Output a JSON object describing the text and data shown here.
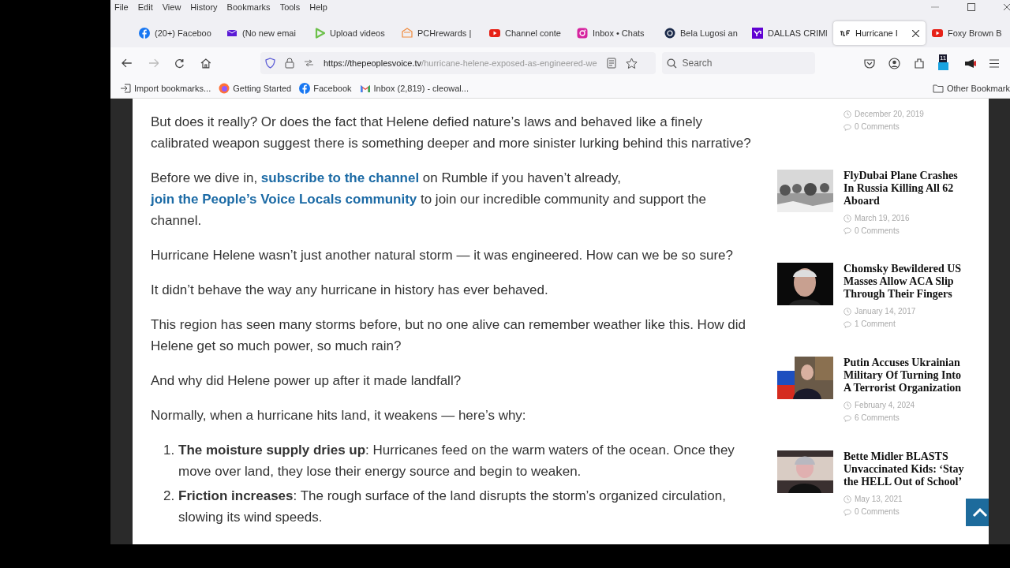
{
  "menu": [
    "File",
    "Edit",
    "View",
    "History",
    "Bookmarks",
    "Tools",
    "Help"
  ],
  "tabs": [
    {
      "label": "(20+) Faceboo",
      "kind": "facebook",
      "selected": false
    },
    {
      "label": "(No new emai",
      "kind": "mail",
      "selected": false
    },
    {
      "label": "Upload videos",
      "kind": "play",
      "selected": false
    },
    {
      "label": "PCHrewards |",
      "kind": "pch",
      "selected": false
    },
    {
      "label": "Channel conte",
      "kind": "youtube",
      "selected": false
    },
    {
      "label": "Inbox • Chats",
      "kind": "instagram",
      "selected": false
    },
    {
      "label": "Bela Lugosi an",
      "kind": "circle",
      "selected": false
    },
    {
      "label": "DALLAS CRIMI",
      "kind": "yahoo",
      "selected": false
    },
    {
      "label": "Hurricane I",
      "kind": "site",
      "selected": true
    },
    {
      "label": "Foxy Brown B",
      "kind": "youtube",
      "selected": false
    }
  ],
  "url": {
    "host": "https://thepeoplesvoice.tv",
    "path": "/hurricane-helene-exposed-as-engineered-we"
  },
  "search": {
    "placeholder": "Search"
  },
  "extension_badge": "11",
  "bookmarks": [
    {
      "label": "Import bookmarks...",
      "kind": "import"
    },
    {
      "label": "Getting Started",
      "kind": "firefox"
    },
    {
      "label": "Facebook",
      "kind": "facebook"
    },
    {
      "label": "Inbox (2,819) - cleowal...",
      "kind": "gmail"
    }
  ],
  "other_bookmarks": "Other Bookmark",
  "article": [
    {
      "kind": "p",
      "segments": [
        {
          "text": "But does it really? Or does the fact that Helene defied nature’s laws and behaved like a finely calibrated weapon suggest there is something deeper and more sinister lurking behind this narrative?",
          "link": false
        }
      ]
    },
    {
      "kind": "p",
      "segments": [
        {
          "text": "Before we dive in, ",
          "link": false
        },
        {
          "text": "subscribe to the channel",
          "link": true
        },
        {
          "text": " on Rumble if you haven’t already, ",
          "link": false
        },
        {
          "text": "join the People’s Voice Locals community",
          "link": true
        },
        {
          "text": " to join our incredible community and support the channel.",
          "link": false
        }
      ]
    },
    {
      "kind": "p",
      "segments": [
        {
          "text": "Hurricane Helene wasn’t just another natural storm — it was engineered. How can we be so sure?",
          "link": false
        }
      ]
    },
    {
      "kind": "p",
      "segments": [
        {
          "text": "It didn’t behave the way any hurricane in history has ever behaved.",
          "link": false
        }
      ]
    },
    {
      "kind": "p",
      "segments": [
        {
          "text": "This region has seen many storms before, but no one alive can remember weather like this. How did Helene get so much power, so much rain?",
          "link": false
        }
      ]
    },
    {
      "kind": "p",
      "segments": [
        {
          "text": "And why did Helene power up after it made landfall?",
          "link": false
        }
      ]
    },
    {
      "kind": "p",
      "segments": [
        {
          "text": "Normally, when a hurricane hits land, it weakens — here’s why:",
          "link": false
        }
      ]
    },
    {
      "kind": "list",
      "items": [
        {
          "number": "1.",
          "text": "**The moisture supply dries up**: Hurricanes feed on the warm waters of the ocean. Once they move over land, they lose their energy source and begin to weaken."
        },
        {
          "number": "2.",
          "text": "**Friction increases**: The rough surface of the land disrupts the storm’s organized circulation, slowing its wind speeds."
        }
      ]
    }
  ],
  "sidebar": [
    {
      "date": "December 20, 2019",
      "comments": "0 Comments"
    },
    {
      "title": "FlyDubai Plane Crashes In Russia Killing All 62 Aboard",
      "date": "March 19, 2016",
      "comments": "0 Comments",
      "kind": "picture"
    },
    {
      "title": "Chomsky Bewildered US Masses Allow ACA Slip Through Their Fingers",
      "date": "January 14, 2017",
      "comments": "1 Comment",
      "kind": "picture"
    },
    {
      "title": "Putin Accuses Ukrainian Military Of Turning Into A Terrorist Organization",
      "date": "February 4, 2024",
      "comments": "6 Comments",
      "kind": "picture"
    },
    {
      "title": "Bette Midler BLASTS Unvaccinated Kids: ‘Stay the HELL Out of School’",
      "date": "May 13, 2021",
      "comments": "0 Comments",
      "kind": "picture"
    }
  ]
}
